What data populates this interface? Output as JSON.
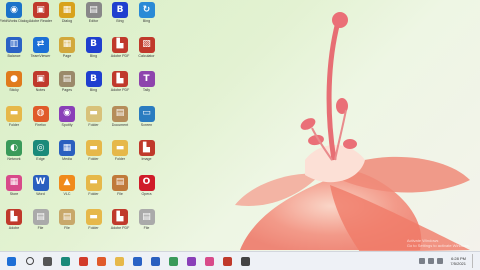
{
  "desktop": {
    "icons": [
      {
        "label": "FieldWorks Dialog",
        "glyph": "◉",
        "color": "#1a73c9"
      },
      {
        "label": "Adobe Reader",
        "glyph": "▣",
        "color": "#c0392b"
      },
      {
        "label": "Dialog",
        "glyph": "▦",
        "color": "#d8a21c"
      },
      {
        "label": "Editor",
        "glyph": "▤",
        "color": "#888"
      },
      {
        "label": "Bing",
        "glyph": "B",
        "color": "#1f3fcf"
      },
      {
        "label": "Bing",
        "glyph": "↻",
        "color": "#2a8ad6"
      },
      {
        "label": "Balance",
        "glyph": "▥",
        "color": "#2a62c5"
      },
      {
        "label": "TeamViewer",
        "glyph": "⇄",
        "color": "#1b6fd6"
      },
      {
        "label": "Page",
        "glyph": "▦",
        "color": "#d2a83c"
      },
      {
        "label": "Bing",
        "glyph": "B",
        "color": "#1f3fcf"
      },
      {
        "label": "Adobe PDF",
        "glyph": "▙",
        "color": "#c0392b"
      },
      {
        "label": "Calculator",
        "glyph": "▧",
        "color": "#c0392b"
      },
      {
        "label": "Sticky",
        "glyph": "●",
        "color": "#e07b1c"
      },
      {
        "label": "Notes",
        "glyph": "▣",
        "color": "#c0392b"
      },
      {
        "label": "Pages",
        "glyph": "▤",
        "color": "#9b8a6a"
      },
      {
        "label": "Bing",
        "glyph": "B",
        "color": "#1f3fcf"
      },
      {
        "label": "Adobe PDF",
        "glyph": "▙",
        "color": "#c0392b"
      },
      {
        "label": "Tally",
        "glyph": "T",
        "color": "#8e44ad"
      },
      {
        "label": "Folder",
        "glyph": "▬",
        "color": "#e6b84a"
      },
      {
        "label": "Firefox",
        "glyph": "◍",
        "color": "#e05a2a"
      },
      {
        "label": "Spotify",
        "glyph": "◉",
        "color": "#8a3fb8"
      },
      {
        "label": "Folder",
        "glyph": "▬",
        "color": "#d8c27a"
      },
      {
        "label": "Document",
        "glyph": "▤",
        "color": "#b58d5a"
      },
      {
        "label": "Screen",
        "glyph": "▭",
        "color": "#2a7cc0"
      },
      {
        "label": "Network",
        "glyph": "◐",
        "color": "#3a9a5a"
      },
      {
        "label": "Edge",
        "glyph": "◎",
        "color": "#1a8a7a"
      },
      {
        "label": "Media",
        "glyph": "▦",
        "color": "#2a5fbf"
      },
      {
        "label": "Folder",
        "glyph": "▬",
        "color": "#e6b84a"
      },
      {
        "label": "Folder",
        "glyph": "▬",
        "color": "#e6b84a"
      },
      {
        "label": "Image",
        "glyph": "▙",
        "color": "#c0392b"
      },
      {
        "label": "Store",
        "glyph": "▦",
        "color": "#d84a8a"
      },
      {
        "label": "Word",
        "glyph": "W",
        "color": "#2a5fbf"
      },
      {
        "label": "VLC",
        "glyph": "▲",
        "color": "#f08a1c"
      },
      {
        "label": "Folder",
        "glyph": "▬",
        "color": "#e6b84a"
      },
      {
        "label": "File",
        "glyph": "▤",
        "color": "#c07a3a"
      },
      {
        "label": "Opera",
        "glyph": "O",
        "color": "#d01c2a"
      },
      {
        "label": "Adobe",
        "glyph": "▙",
        "color": "#c0392b"
      },
      {
        "label": "File",
        "glyph": "▤",
        "color": "#aaa"
      },
      {
        "label": "File",
        "glyph": "▤",
        "color": "#c8a86a"
      },
      {
        "label": "Folder",
        "glyph": "▬",
        "color": "#e6b84a"
      },
      {
        "label": "Adobe PDF",
        "glyph": "▙",
        "color": "#c0392b"
      },
      {
        "label": "File",
        "glyph": "▤",
        "color": "#aaa"
      }
    ]
  },
  "watermark": {
    "line1": "Activate Windows",
    "line2": "Go to Settings to activate Windows."
  },
  "taskbar": {
    "items": [
      {
        "name": "start",
        "color": "#1f6fd6"
      },
      {
        "name": "search",
        "color": "#444"
      },
      {
        "name": "task-view",
        "color": "#555"
      },
      {
        "name": "edge",
        "color": "#1a8a7a"
      },
      {
        "name": "chrome",
        "color": "#d23b2a"
      },
      {
        "name": "firefox",
        "color": "#e05a2a"
      },
      {
        "name": "file-explorer",
        "color": "#e6b84a"
      },
      {
        "name": "store",
        "color": "#2a62c5"
      },
      {
        "name": "word",
        "color": "#2a5fbf"
      },
      {
        "name": "app",
        "color": "#3a9a5a"
      },
      {
        "name": "app",
        "color": "#8a3fb8"
      },
      {
        "name": "app",
        "color": "#d84a8a"
      },
      {
        "name": "app",
        "color": "#c0392b"
      },
      {
        "name": "app",
        "color": "#444"
      }
    ],
    "time": "6:28 PM",
    "date": "7/5/2021"
  }
}
